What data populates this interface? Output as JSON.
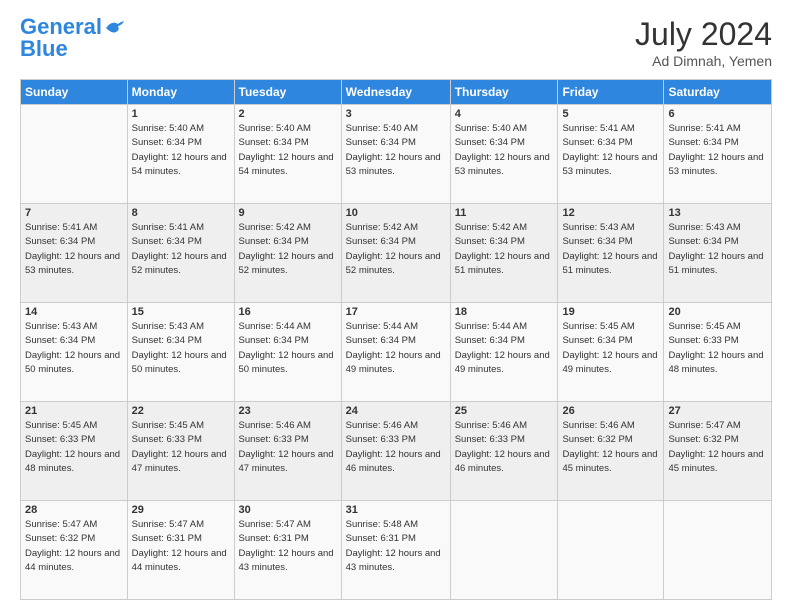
{
  "header": {
    "logo_line1": "General",
    "logo_line2": "Blue",
    "month_year": "July 2024",
    "location": "Ad Dimnah, Yemen"
  },
  "weekdays": [
    "Sunday",
    "Monday",
    "Tuesday",
    "Wednesday",
    "Thursday",
    "Friday",
    "Saturday"
  ],
  "weeks": [
    [
      {
        "day": "",
        "sunrise": "",
        "sunset": "",
        "daylight": ""
      },
      {
        "day": "1",
        "sunrise": "Sunrise: 5:40 AM",
        "sunset": "Sunset: 6:34 PM",
        "daylight": "Daylight: 12 hours and 54 minutes."
      },
      {
        "day": "2",
        "sunrise": "Sunrise: 5:40 AM",
        "sunset": "Sunset: 6:34 PM",
        "daylight": "Daylight: 12 hours and 54 minutes."
      },
      {
        "day": "3",
        "sunrise": "Sunrise: 5:40 AM",
        "sunset": "Sunset: 6:34 PM",
        "daylight": "Daylight: 12 hours and 53 minutes."
      },
      {
        "day": "4",
        "sunrise": "Sunrise: 5:40 AM",
        "sunset": "Sunset: 6:34 PM",
        "daylight": "Daylight: 12 hours and 53 minutes."
      },
      {
        "day": "5",
        "sunrise": "Sunrise: 5:41 AM",
        "sunset": "Sunset: 6:34 PM",
        "daylight": "Daylight: 12 hours and 53 minutes."
      },
      {
        "day": "6",
        "sunrise": "Sunrise: 5:41 AM",
        "sunset": "Sunset: 6:34 PM",
        "daylight": "Daylight: 12 hours and 53 minutes."
      }
    ],
    [
      {
        "day": "7",
        "sunrise": "Sunrise: 5:41 AM",
        "sunset": "Sunset: 6:34 PM",
        "daylight": "Daylight: 12 hours and 53 minutes."
      },
      {
        "day": "8",
        "sunrise": "Sunrise: 5:41 AM",
        "sunset": "Sunset: 6:34 PM",
        "daylight": "Daylight: 12 hours and 52 minutes."
      },
      {
        "day": "9",
        "sunrise": "Sunrise: 5:42 AM",
        "sunset": "Sunset: 6:34 PM",
        "daylight": "Daylight: 12 hours and 52 minutes."
      },
      {
        "day": "10",
        "sunrise": "Sunrise: 5:42 AM",
        "sunset": "Sunset: 6:34 PM",
        "daylight": "Daylight: 12 hours and 52 minutes."
      },
      {
        "day": "11",
        "sunrise": "Sunrise: 5:42 AM",
        "sunset": "Sunset: 6:34 PM",
        "daylight": "Daylight: 12 hours and 51 minutes."
      },
      {
        "day": "12",
        "sunrise": "Sunrise: 5:43 AM",
        "sunset": "Sunset: 6:34 PM",
        "daylight": "Daylight: 12 hours and 51 minutes."
      },
      {
        "day": "13",
        "sunrise": "Sunrise: 5:43 AM",
        "sunset": "Sunset: 6:34 PM",
        "daylight": "Daylight: 12 hours and 51 minutes."
      }
    ],
    [
      {
        "day": "14",
        "sunrise": "Sunrise: 5:43 AM",
        "sunset": "Sunset: 6:34 PM",
        "daylight": "Daylight: 12 hours and 50 minutes."
      },
      {
        "day": "15",
        "sunrise": "Sunrise: 5:43 AM",
        "sunset": "Sunset: 6:34 PM",
        "daylight": "Daylight: 12 hours and 50 minutes."
      },
      {
        "day": "16",
        "sunrise": "Sunrise: 5:44 AM",
        "sunset": "Sunset: 6:34 PM",
        "daylight": "Daylight: 12 hours and 50 minutes."
      },
      {
        "day": "17",
        "sunrise": "Sunrise: 5:44 AM",
        "sunset": "Sunset: 6:34 PM",
        "daylight": "Daylight: 12 hours and 49 minutes."
      },
      {
        "day": "18",
        "sunrise": "Sunrise: 5:44 AM",
        "sunset": "Sunset: 6:34 PM",
        "daylight": "Daylight: 12 hours and 49 minutes."
      },
      {
        "day": "19",
        "sunrise": "Sunrise: 5:45 AM",
        "sunset": "Sunset: 6:34 PM",
        "daylight": "Daylight: 12 hours and 49 minutes."
      },
      {
        "day": "20",
        "sunrise": "Sunrise: 5:45 AM",
        "sunset": "Sunset: 6:33 PM",
        "daylight": "Daylight: 12 hours and 48 minutes."
      }
    ],
    [
      {
        "day": "21",
        "sunrise": "Sunrise: 5:45 AM",
        "sunset": "Sunset: 6:33 PM",
        "daylight": "Daylight: 12 hours and 48 minutes."
      },
      {
        "day": "22",
        "sunrise": "Sunrise: 5:45 AM",
        "sunset": "Sunset: 6:33 PM",
        "daylight": "Daylight: 12 hours and 47 minutes."
      },
      {
        "day": "23",
        "sunrise": "Sunrise: 5:46 AM",
        "sunset": "Sunset: 6:33 PM",
        "daylight": "Daylight: 12 hours and 47 minutes."
      },
      {
        "day": "24",
        "sunrise": "Sunrise: 5:46 AM",
        "sunset": "Sunset: 6:33 PM",
        "daylight": "Daylight: 12 hours and 46 minutes."
      },
      {
        "day": "25",
        "sunrise": "Sunrise: 5:46 AM",
        "sunset": "Sunset: 6:33 PM",
        "daylight": "Daylight: 12 hours and 46 minutes."
      },
      {
        "day": "26",
        "sunrise": "Sunrise: 5:46 AM",
        "sunset": "Sunset: 6:32 PM",
        "daylight": "Daylight: 12 hours and 45 minutes."
      },
      {
        "day": "27",
        "sunrise": "Sunrise: 5:47 AM",
        "sunset": "Sunset: 6:32 PM",
        "daylight": "Daylight: 12 hours and 45 minutes."
      }
    ],
    [
      {
        "day": "28",
        "sunrise": "Sunrise: 5:47 AM",
        "sunset": "Sunset: 6:32 PM",
        "daylight": "Daylight: 12 hours and 44 minutes."
      },
      {
        "day": "29",
        "sunrise": "Sunrise: 5:47 AM",
        "sunset": "Sunset: 6:31 PM",
        "daylight": "Daylight: 12 hours and 44 minutes."
      },
      {
        "day": "30",
        "sunrise": "Sunrise: 5:47 AM",
        "sunset": "Sunset: 6:31 PM",
        "daylight": "Daylight: 12 hours and 43 minutes."
      },
      {
        "day": "31",
        "sunrise": "Sunrise: 5:48 AM",
        "sunset": "Sunset: 6:31 PM",
        "daylight": "Daylight: 12 hours and 43 minutes."
      },
      {
        "day": "",
        "sunrise": "",
        "sunset": "",
        "daylight": ""
      },
      {
        "day": "",
        "sunrise": "",
        "sunset": "",
        "daylight": ""
      },
      {
        "day": "",
        "sunrise": "",
        "sunset": "",
        "daylight": ""
      }
    ]
  ]
}
